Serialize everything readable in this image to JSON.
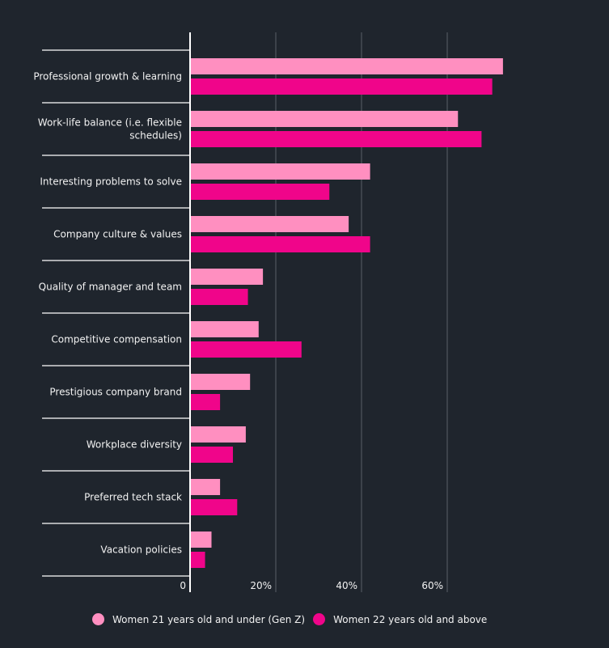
{
  "chart_data": {
    "type": "bar",
    "orientation": "horizontal",
    "title": "",
    "xlabel": "",
    "ylabel": "",
    "xlim": [
      0,
      75
    ],
    "x_ticks": [
      {
        "value": 0,
        "label": "0"
      },
      {
        "value": 20,
        "label": "20%"
      },
      {
        "value": 40,
        "label": "40%"
      },
      {
        "value": 60,
        "label": "60%"
      }
    ],
    "grid": true,
    "legend_position": "bottom",
    "categories": [
      [
        "Professional growth & learning"
      ],
      [
        "Work-life balance (i.e. flexible",
        "schedules)"
      ],
      [
        "Interesting problems to solve"
      ],
      [
        "Company culture & values"
      ],
      [
        "Quality of manager and team"
      ],
      [
        "Competitive compensation"
      ],
      [
        "Prestigious company brand"
      ],
      [
        "Workplace diversity"
      ],
      [
        "Preferred tech stack"
      ],
      [
        "Vacation policies"
      ]
    ],
    "series": [
      {
        "name": "Women 21 years old and under (Gen Z)",
        "color": "#ff8fc0",
        "values": [
          73,
          62.5,
          42,
          37,
          17,
          16,
          14,
          13,
          7,
          5
        ]
      },
      {
        "name": "Women 22 years old and above",
        "color": "#f0058a",
        "values": [
          70.5,
          68,
          32.5,
          42,
          13.5,
          26,
          7,
          10,
          11,
          3.5
        ]
      }
    ]
  },
  "colors": {
    "background": "#1f252d",
    "axis": "#ffffff",
    "grid": "#5a6068",
    "text": "#f2f2f2"
  }
}
